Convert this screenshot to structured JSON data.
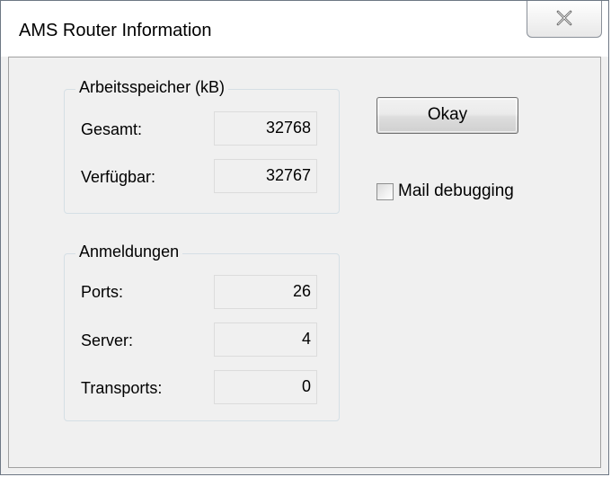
{
  "window": {
    "title": "AMS Router Information",
    "close_icon": "close-icon"
  },
  "memory_group": {
    "label": "Arbeitsspeicher (kB)",
    "rows": [
      {
        "label": "Gesamt:",
        "value": "32768"
      },
      {
        "label": "Verfügbar:",
        "value": "32767"
      }
    ]
  },
  "logins_group": {
    "label": "Anmeldungen",
    "rows": [
      {
        "label": "Ports:",
        "value": "26"
      },
      {
        "label": "Server:",
        "value": "4"
      },
      {
        "label": "Transports:",
        "value": "0"
      }
    ]
  },
  "buttons": {
    "okay_label": "Okay"
  },
  "options": {
    "mail_debugging_label": "Mail debugging",
    "mail_debugging_checked": false
  },
  "colors": {
    "dialog_background": "#f0f0f0",
    "titlebar_background": "#ffffff",
    "group_border": "#d5dfe5"
  }
}
